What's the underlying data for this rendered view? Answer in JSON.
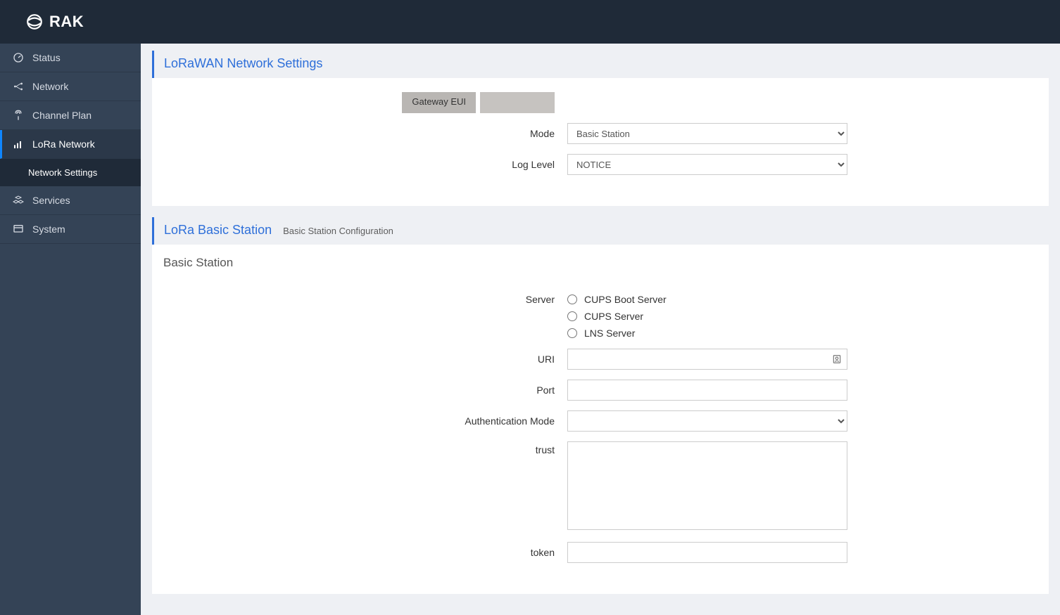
{
  "brand": {
    "name": "RAK"
  },
  "sidebar": {
    "items": [
      {
        "label": "Status"
      },
      {
        "label": "Network"
      },
      {
        "label": "Channel Plan"
      },
      {
        "label": "LoRa Network"
      },
      {
        "label": "Services"
      },
      {
        "label": "System"
      }
    ],
    "sub": {
      "network_settings": "Network Settings"
    }
  },
  "panel1": {
    "title": "LoRaWAN Network Settings",
    "gateway_eui_label": "Gateway EUI",
    "gateway_eui_value": "",
    "mode_label": "Mode",
    "mode_value": "Basic Station",
    "loglevel_label": "Log Level",
    "loglevel_value": "NOTICE"
  },
  "panel2": {
    "title": "LoRa Basic Station",
    "subtitle": "Basic Station Configuration",
    "subheading": "Basic Station",
    "server_label": "Server",
    "server_options": [
      "CUPS Boot Server",
      "CUPS Server",
      "LNS Server"
    ],
    "uri_label": "URI",
    "uri_value": "",
    "port_label": "Port",
    "port_value": "",
    "auth_label": "Authentication Mode",
    "auth_value": "",
    "trust_label": "trust",
    "trust_value": "",
    "token_label": "token",
    "token_value": ""
  }
}
